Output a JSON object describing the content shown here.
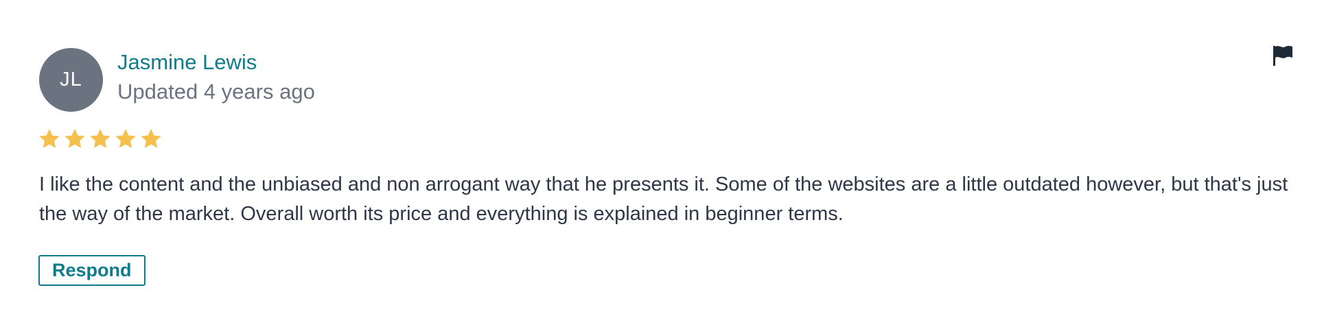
{
  "review": {
    "avatar_initials": "JL",
    "author_name": "Jasmine Lewis",
    "updated_text": "Updated 4 years ago",
    "rating": 5,
    "rating_max": 5,
    "text": "I like the content and the unbiased and non arrogant way that he presents it. Some of the websites are a little outdated however, but that's just the way of the market. Overall worth its price and everything is explained in beginner terms.",
    "respond_label": "Respond",
    "flag_icon": "flag-icon",
    "star_icon": "star-icon"
  },
  "colors": {
    "accent": "#0f7c8c",
    "avatar_bg": "#6b7280",
    "star": "#f5c04e",
    "muted_text": "#6b7280",
    "body_text": "#2d3748",
    "flag": "#1f2a37"
  }
}
